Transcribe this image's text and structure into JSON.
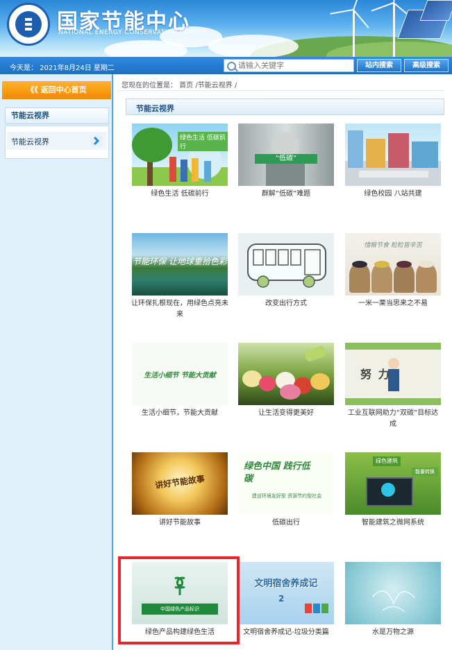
{
  "header": {
    "site_title": "国家节能中心",
    "site_subtitle": "NATIONAL ENERGY CONSERVATION CENTER"
  },
  "topbar": {
    "date": "今天是： 2021年8月24日  星期二",
    "search_placeholder": "请输入关键字",
    "site_search_label": "站内搜索",
    "advanced_search_label": "高级搜索"
  },
  "sidebar": {
    "back_label": "《《 返回中心首页",
    "section_title": "节能云视界",
    "items": [
      {
        "label": "节能云视界"
      }
    ]
  },
  "breadcrumb": "您现在的位置是： 首页 /节能云视界 /",
  "section_title": "节能云视界",
  "videos": [
    {
      "caption": "绿色生活 低碳前行",
      "thumb_text": "绿色生活  低碳前行"
    },
    {
      "caption": "群解“低碳”难题",
      "thumb_text": "“低碳”"
    },
    {
      "caption": "绿色校园 八站共建",
      "thumb_text": ""
    },
    {
      "caption": "让环保扎根现在，用绿色点亮未来",
      "thumb_text": "节能环保 让地球重拾色彩"
    },
    {
      "caption": "改变出行方式",
      "thumb_text": ""
    },
    {
      "caption": "一米一栗当思来之不易",
      "thumb_text": "惜粮节食  粒粒皆辛苦"
    },
    {
      "caption": "生活小细节，节能大贡献",
      "thumb_text": "生活小细节  节能大贡献"
    },
    {
      "caption": "让生活变得更美好",
      "thumb_text": ""
    },
    {
      "caption": "工业互联网助力“双碳”目标达成",
      "thumb_text": "努  力"
    },
    {
      "caption": "讲好节能故事",
      "thumb_text": "讲好节能故事"
    },
    {
      "caption": "低碳出行",
      "thumb_text": "绿色中国 践行低碳"
    },
    {
      "caption": "智能建筑之微网系统",
      "thumb_text": "绿色建筑"
    },
    {
      "caption": "绿色产品构建绿色生活",
      "thumb_text": "中国绿色产品标识"
    },
    {
      "caption": "文明宿舍养成记-垃圾分类篇",
      "thumb_text": "文明宿舍养成记"
    },
    {
      "caption": "水是万物之源",
      "thumb_text": ""
    }
  ],
  "colors": {
    "accent_blue": "#1d6fc4",
    "back_button_orange": "#f08a00",
    "highlight_red": "#e8252b"
  }
}
